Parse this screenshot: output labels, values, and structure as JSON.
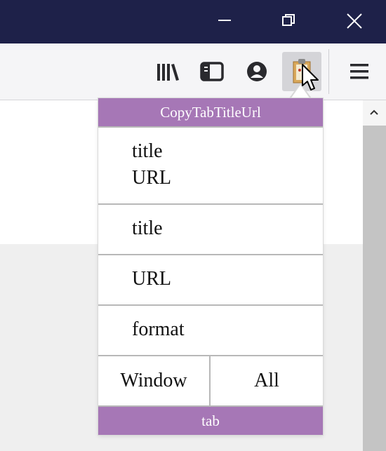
{
  "window_controls": {
    "minimize_icon": "minimize-icon",
    "restore_icon": "restore-icon",
    "close_icon": "close-icon"
  },
  "toolbar": {
    "icons": [
      "library-icon",
      "sidebar-icon",
      "account-icon",
      "clipboard-icon",
      "hamburger-menu-icon"
    ]
  },
  "popup": {
    "title": "CopyTabTitleUrl",
    "options": {
      "title_url_line1": "title",
      "title_url_line2": "URL",
      "title": "title",
      "url": "URL",
      "format": "format",
      "window": "Window",
      "all": "All"
    },
    "footer": "tab"
  },
  "colors": {
    "titlebar": "#1e2149",
    "popup_accent": "#a677b6"
  }
}
